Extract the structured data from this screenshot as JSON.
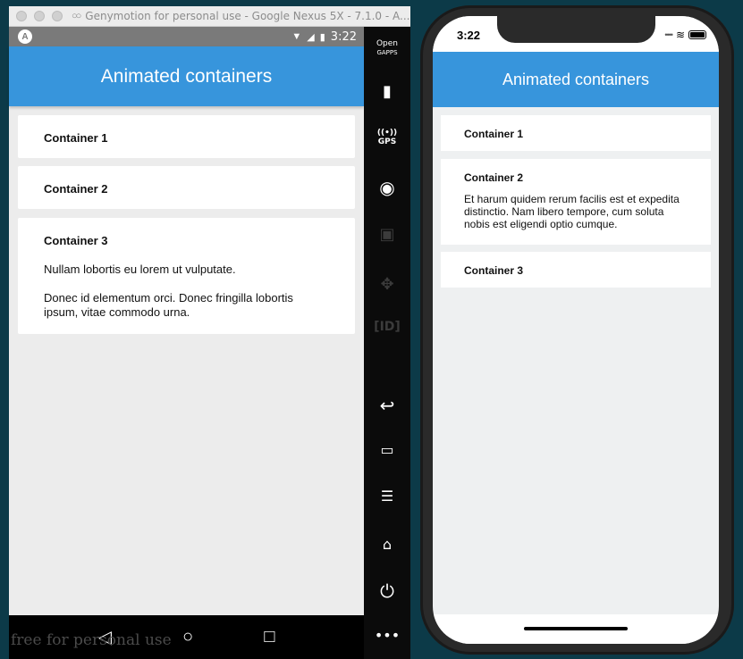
{
  "genymotion": {
    "window_title": "Genymotion for personal use - Google Nexus 5X - 7.1.0 - A...",
    "watermark": "free for personal use",
    "sidebar": [
      {
        "name": "opengapps-button",
        "label": "Open\nGAPPS"
      },
      {
        "name": "battery-button",
        "label": "battery"
      },
      {
        "name": "gps-button",
        "label": "GPS"
      },
      {
        "name": "webcam-button",
        "label": "webcam"
      },
      {
        "name": "media-button",
        "label": "media"
      },
      {
        "name": "dpad-button",
        "label": "dpad"
      },
      {
        "name": "id-button",
        "label": "ID"
      },
      {
        "name": "back-button",
        "label": "back"
      },
      {
        "name": "recent-apps-button",
        "label": "recent apps"
      },
      {
        "name": "menu-button",
        "label": "menu"
      },
      {
        "name": "home-button",
        "label": "home"
      },
      {
        "name": "power-button",
        "label": "power"
      },
      {
        "name": "more-button",
        "label": "more"
      }
    ]
  },
  "android": {
    "status_time": "3:22",
    "app_title": "Animated containers",
    "containers": [
      {
        "title": "Container 1",
        "body": []
      },
      {
        "title": "Container 2",
        "body": []
      },
      {
        "title": "Container 3",
        "body": [
          "Nullam lobortis eu lorem ut vulputate.",
          "Donec id elementum orci. Donec fringilla lobortis ipsum, vitae commodo urna."
        ]
      }
    ]
  },
  "ios": {
    "status_time": "3:22",
    "app_title": "Animated containers",
    "containers": [
      {
        "title": "Container 1",
        "body": ""
      },
      {
        "title": "Container 2",
        "body": "Et harum quidem rerum facilis est et expedita distinctio. Nam libero tempore, cum soluta nobis est eligendi optio cumque."
      },
      {
        "title": "Container 3",
        "body": ""
      }
    ]
  },
  "colors": {
    "accent": "#3795dc",
    "background": "#ececec",
    "desktop": "#0c3a48"
  }
}
